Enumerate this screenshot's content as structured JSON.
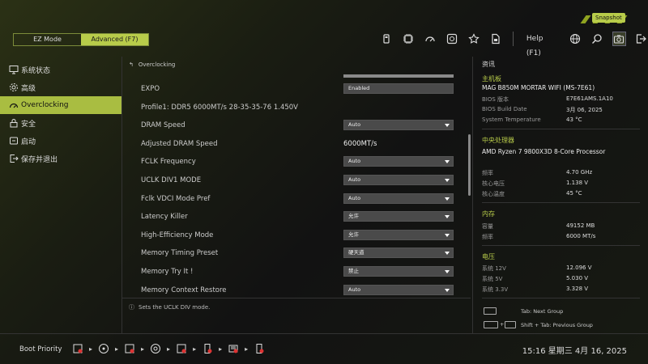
{
  "header": {
    "modes": [
      {
        "label": "EZ Mode",
        "active": false
      },
      {
        "label": "Advanced (F7)",
        "active": true
      }
    ],
    "icons": [
      "usb-icon",
      "cpu-icon",
      "speedometer-icon",
      "fan-icon",
      "star-icon",
      "file-icon"
    ],
    "help_label": "Help (F1)",
    "right_icons": [
      "globe-icon",
      "search-icon",
      "camera-icon",
      "exit-icon"
    ],
    "snapshot_tip": "Snapshot"
  },
  "sidebar": {
    "items": [
      {
        "label": "系统状态",
        "icon": "monitor-icon",
        "active": false
      },
      {
        "label": "高级",
        "icon": "gear-icon",
        "active": false
      },
      {
        "label": "Overclocking",
        "icon": "speedometer-icon",
        "active": true
      },
      {
        "label": "安全",
        "icon": "lock-icon",
        "active": false
      },
      {
        "label": "启动",
        "icon": "boot-icon",
        "active": false
      },
      {
        "label": "保存并退出",
        "icon": "exit-icon",
        "active": false
      }
    ]
  },
  "main": {
    "breadcrumb": "Overclocking",
    "rows": [
      {
        "label": "EXPO",
        "value": "Enabled",
        "type": "select"
      },
      {
        "label": "Profile1: DDR5 6000MT/s 28-35-35-76 1.450V",
        "value": "",
        "type": "info"
      },
      {
        "label": "DRAM Speed",
        "value": "Auto",
        "type": "select"
      },
      {
        "label": "Adjusted DRAM Speed",
        "value": "6000MT/s",
        "type": "text"
      },
      {
        "label": "FCLK Frequency",
        "value": "Auto",
        "type": "select"
      },
      {
        "label": "UCLK DIV1 MODE",
        "value": "Auto",
        "type": "select"
      },
      {
        "label": "Fclk VDCI Mode Pref",
        "value": "Auto",
        "type": "select"
      },
      {
        "label": "Latency Killer",
        "value": "允许",
        "type": "select"
      },
      {
        "label": "High-Efficiency Mode",
        "value": "允许",
        "type": "select"
      },
      {
        "label": "Memory Timing Preset",
        "value": "硬天道",
        "type": "select"
      },
      {
        "label": "Memory Try It !",
        "value": "禁止",
        "type": "select"
      },
      {
        "label": "Memory Context Restore",
        "value": "Auto",
        "type": "select"
      }
    ],
    "hint": "Sets the UCLK DIV mode."
  },
  "info": {
    "title": "资讯",
    "board_section": "主机板",
    "board_name": "MAG B850M MORTAR WIFI (MS-7E61)",
    "board_kv": [
      {
        "k": "BIOS 版本",
        "v": "E7E61AMS.1A10"
      },
      {
        "k": "BIOS Build Date",
        "v": "3月 06, 2025"
      },
      {
        "k": "System Temperature",
        "v": "43 °C"
      }
    ],
    "cpu_section": "中央处理器",
    "cpu_name": "AMD Ryzen 7 9800X3D 8-Core Processor",
    "cpu_kv": [
      {
        "k": "频率",
        "v": "4.70 GHz"
      },
      {
        "k": "核心电压",
        "v": "1.138 V"
      },
      {
        "k": "核心温度",
        "v": "45 °C"
      }
    ],
    "mem_section": "内存",
    "mem_kv": [
      {
        "k": "容量",
        "v": "49152 MB"
      },
      {
        "k": "频率",
        "v": "6000 MT/s"
      }
    ],
    "volt_section": "电压",
    "volt_kv": [
      {
        "k": "系统 12V",
        "v": "12.096 V"
      },
      {
        "k": "系统 5V",
        "v": "5.030 V"
      },
      {
        "k": "系统 3.3V",
        "v": "3.328 V"
      }
    ],
    "keys": [
      {
        "label": "Tab: Next Group"
      },
      {
        "label": "Shift + Tab: Previous Group"
      }
    ]
  },
  "bottom": {
    "boot_label": "Boot Priority",
    "clock": "15:16  星期三 4月 16, 2025"
  },
  "colors": {
    "accent": "#b8cc4a"
  }
}
